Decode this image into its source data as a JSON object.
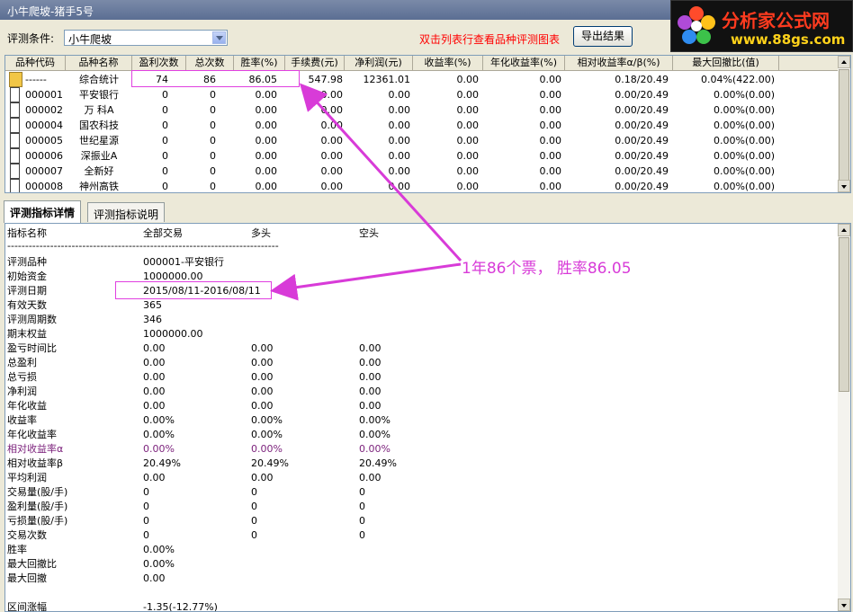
{
  "window": {
    "title": "小牛爬坡-猪手5号"
  },
  "logo": {
    "brand": "分析家公式网",
    "url": "www.88gs.com"
  },
  "toolbar": {
    "condition_label": "评测条件:",
    "condition_value": "小牛爬坡",
    "hint": "双击列表行查看品种评测图表",
    "export_label": "导出结果"
  },
  "grid": {
    "columns": [
      "品种代码",
      "品种名称",
      "盈利次数",
      "总次数",
      "胜率(%)",
      "手续费(元)",
      "净利润(元)",
      "收益率(%)",
      "年化收益率(%)",
      "相对收益率α/β(%)",
      "最大回撤比(值)"
    ],
    "rows": [
      {
        "code": "------",
        "name": "综合统计",
        "wins": "74",
        "total": "86",
        "winrate": "86.05",
        "fee": "547.98",
        "profit": "12361.01",
        "ret": "0.00",
        "annual": "0.00",
        "rel": "0.18/20.49",
        "dd": "0.04%(422.00)",
        "icon": "folder-icon"
      },
      {
        "code": "000001",
        "name": "平安银行",
        "wins": "0",
        "total": "0",
        "winrate": "0.00",
        "fee": "0.00",
        "profit": "0.00",
        "ret": "0.00",
        "annual": "0.00",
        "rel": "0.00/20.49",
        "dd": "0.00%(0.00)",
        "icon": "document-icon"
      },
      {
        "code": "000002",
        "name": "万 科A",
        "wins": "0",
        "total": "0",
        "winrate": "0.00",
        "fee": "0.00",
        "profit": "0.00",
        "ret": "0.00",
        "annual": "0.00",
        "rel": "0.00/20.49",
        "dd": "0.00%(0.00)",
        "icon": "document-icon"
      },
      {
        "code": "000004",
        "name": "国农科技",
        "wins": "0",
        "total": "0",
        "winrate": "0.00",
        "fee": "0.00",
        "profit": "0.00",
        "ret": "0.00",
        "annual": "0.00",
        "rel": "0.00/20.49",
        "dd": "0.00%(0.00)",
        "icon": "document-icon"
      },
      {
        "code": "000005",
        "name": "世纪星源",
        "wins": "0",
        "total": "0",
        "winrate": "0.00",
        "fee": "0.00",
        "profit": "0.00",
        "ret": "0.00",
        "annual": "0.00",
        "rel": "0.00/20.49",
        "dd": "0.00%(0.00)",
        "icon": "document-icon"
      },
      {
        "code": "000006",
        "name": "深振业A",
        "wins": "0",
        "total": "0",
        "winrate": "0.00",
        "fee": "0.00",
        "profit": "0.00",
        "ret": "0.00",
        "annual": "0.00",
        "rel": "0.00/20.49",
        "dd": "0.00%(0.00)",
        "icon": "document-icon"
      },
      {
        "code": "000007",
        "name": "全新好",
        "wins": "0",
        "total": "0",
        "winrate": "0.00",
        "fee": "0.00",
        "profit": "0.00",
        "ret": "0.00",
        "annual": "0.00",
        "rel": "0.00/20.49",
        "dd": "0.00%(0.00)",
        "icon": "document-icon"
      },
      {
        "code": "000008",
        "name": "神州高铁",
        "wins": "0",
        "total": "0",
        "winrate": "0.00",
        "fee": "0.00",
        "profit": "0.00",
        "ret": "0.00",
        "annual": "0.00",
        "rel": "0.00/20.49",
        "dd": "0.00%(0.00)",
        "icon": "document-icon"
      }
    ]
  },
  "tabs": [
    {
      "label": "评测指标详情",
      "active": true
    },
    {
      "label": "评测指标说明",
      "active": false
    }
  ],
  "detail": {
    "headers": [
      "指标名称",
      "全部交易",
      "多头",
      "空头"
    ],
    "separator": "----------------------------------------------------------------------------",
    "rows": [
      {
        "name": "评测品种",
        "all": "000001-平安银行",
        "long": "",
        "short": ""
      },
      {
        "name": "初始资金",
        "all": "1000000.00",
        "long": "",
        "short": ""
      },
      {
        "name": "评测日期",
        "all": "2015/08/11-2016/08/11",
        "long": "",
        "short": ""
      },
      {
        "name": "有效天数",
        "all": "365",
        "long": "",
        "short": ""
      },
      {
        "name": "评测周期数",
        "all": "346",
        "long": "",
        "short": ""
      },
      {
        "name": "期末权益",
        "all": "1000000.00",
        "long": "",
        "short": ""
      },
      {
        "name": "盈亏时间比",
        "all": "0.00",
        "long": "0.00",
        "short": "0.00"
      },
      {
        "name": "总盈利",
        "all": "0.00",
        "long": "0.00",
        "short": "0.00"
      },
      {
        "name": "总亏损",
        "all": "0.00",
        "long": "0.00",
        "short": "0.00"
      },
      {
        "name": "净利润",
        "all": "0.00",
        "long": "0.00",
        "short": "0.00"
      },
      {
        "name": "年化收益",
        "all": "0.00",
        "long": "0.00",
        "short": "0.00"
      },
      {
        "name": "收益率",
        "all": "0.00%",
        "long": "0.00%",
        "short": "0.00%"
      },
      {
        "name": "年化收益率",
        "all": "0.00%",
        "long": "0.00%",
        "short": "0.00%"
      },
      {
        "name": "相对收益率α",
        "all": "0.00%",
        "long": "0.00%",
        "short": "0.00%",
        "accent": true
      },
      {
        "name": "相对收益率β",
        "all": "20.49%",
        "long": "20.49%",
        "short": "20.49%"
      },
      {
        "name": "平均利润",
        "all": "0.00",
        "long": "0.00",
        "short": "0.00"
      },
      {
        "name": "交易量(股/手)",
        "all": "0",
        "long": "0",
        "short": "0"
      },
      {
        "name": "盈利量(股/手)",
        "all": "0",
        "long": "0",
        "short": "0"
      },
      {
        "name": "亏损量(股/手)",
        "all": "0",
        "long": "0",
        "short": "0"
      },
      {
        "name": "交易次数",
        "all": "0",
        "long": "0",
        "short": "0"
      },
      {
        "name": "胜率",
        "all": "0.00%",
        "long": "",
        "short": ""
      },
      {
        "name": "最大回撤比",
        "all": "0.00%",
        "long": "",
        "short": ""
      },
      {
        "name": "最大回撤",
        "all": "0.00",
        "long": "",
        "short": ""
      },
      {
        "name": "",
        "all": "",
        "long": "",
        "short": ""
      },
      {
        "name": "区间涨幅",
        "all": "-1.35(-12.77%)",
        "long": "",
        "short": ""
      }
    ]
  },
  "annotation": {
    "text": "1年86个票， 胜率86.05"
  },
  "colors": {
    "annotation": "#d83bd8",
    "hint": "#ff0000",
    "accent_row": "#7a1f7a"
  }
}
